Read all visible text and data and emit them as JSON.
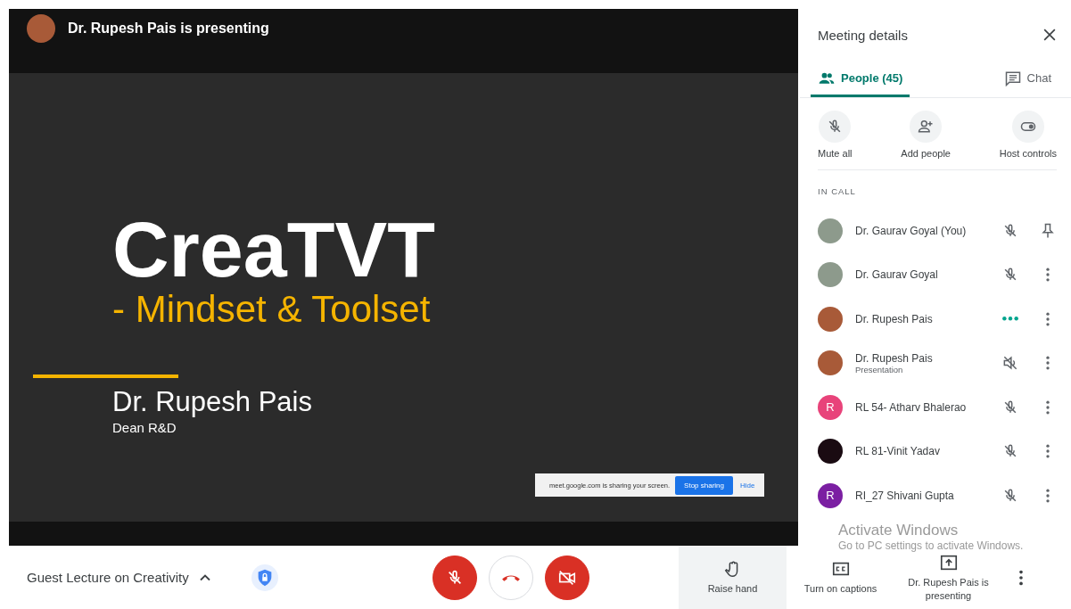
{
  "presenter_bar": {
    "text": "Dr. Rupesh Pais is presenting"
  },
  "slide": {
    "title": "CreaTVT",
    "subtitle": "- Mindset & Toolset",
    "author": "Dr. Rupesh Pais",
    "role": "Dean R&D"
  },
  "share_notice": {
    "text": "meet.google.com is sharing your screen.",
    "stop_button": "Stop sharing",
    "hide_link": "Hide"
  },
  "panel": {
    "title": "Meeting details",
    "tabs": [
      {
        "label": "People (45)",
        "selected": true
      },
      {
        "label": "Chat",
        "selected": false
      }
    ],
    "actions": [
      {
        "label": "Mute all"
      },
      {
        "label": "Add people"
      },
      {
        "label": "Host controls"
      }
    ],
    "section_label": "IN CALL",
    "participants": [
      {
        "name": "Dr. Gaurav Goyal (You)",
        "kind": "self",
        "color": "#8d9a8c",
        "muted": true
      },
      {
        "name": "Dr. Gaurav Goyal",
        "kind": "guest",
        "color": "#8d9a8c",
        "muted": true
      },
      {
        "name": "Dr. Rupesh Pais",
        "kind": "guest",
        "color": "#a85a38",
        "muted": false
      },
      {
        "name": "Dr. Rupesh Pais",
        "subtitle": "Presentation",
        "kind": "presentation",
        "color": "#a85a38",
        "muted": true
      },
      {
        "name": "RL 54- Atharv Bhalerao",
        "kind": "guest",
        "letter": "R",
        "color": "#e8437a",
        "muted": true
      },
      {
        "name": "RL 81-Vinit Yadav",
        "kind": "guest",
        "color": "#1a0b12",
        "muted": true
      },
      {
        "name": "RI_27 Shivani Gupta",
        "kind": "guest",
        "letter": "R",
        "color": "#7b1fa2",
        "muted": true
      }
    ]
  },
  "bottom_bar": {
    "meeting_title": "Guest Lecture on Creativity",
    "mic": {
      "muted": true
    },
    "camera": {
      "muted": true
    },
    "tools": [
      {
        "label": "Raise hand",
        "selected": true
      },
      {
        "label": "Turn on captions",
        "selected": false
      },
      {
        "label": "Dr. Rupesh Pais is presenting",
        "selected": false
      }
    ]
  },
  "os_notice": {
    "title": "Activate Windows",
    "text": "Go to PC settings to activate Windows."
  }
}
